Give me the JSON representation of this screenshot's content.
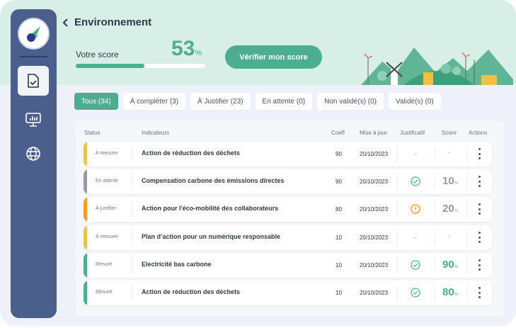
{
  "header": {
    "title": "Environnement",
    "score_label": "Votre score",
    "score_value": "53",
    "score_unit": "%",
    "score_progress": 53,
    "verify_button": "Vérifier mon score"
  },
  "sidebar": {
    "items": [
      {
        "icon": "document-check-icon",
        "active": true
      },
      {
        "icon": "monitor-chart-icon",
        "active": false
      },
      {
        "icon": "globe-icon",
        "active": false
      }
    ]
  },
  "tabs": [
    {
      "label": "Tous (34)",
      "active": true
    },
    {
      "label": "À compléter (3)"
    },
    {
      "label": "À Justifier (23)"
    },
    {
      "label": "En attente (0)"
    },
    {
      "label": "Non validé(s) (0)"
    },
    {
      "label": "Validé(s) (0)"
    }
  ],
  "table": {
    "headers": {
      "status": "Status",
      "indicators": "Indicateurs",
      "coeff": "Coeff",
      "updated": "Mise à jour",
      "proof": "Justificatif",
      "score": "Score",
      "actions": "Actions"
    },
    "rows": [
      {
        "status": "À mesurer",
        "color": "#e8c547",
        "indicator": "Action de réduction des déchets",
        "coeff": "90",
        "date": "20/10/2023",
        "proof": "–",
        "score": "–",
        "score_color": ""
      },
      {
        "status": "En attente",
        "color": "#9a9a9a",
        "indicator": "Compensation carbone des émissions directes",
        "coeff": "90",
        "date": "20/10/2023",
        "proof": "check",
        "score": "10",
        "score_color": "#9a9a9a"
      },
      {
        "status": "À justifier",
        "color": "#f0a020",
        "indicator": "Action pour l'éco-mobilité des collaborateurs",
        "coeff": "80",
        "date": "20/10/2023",
        "proof": "warning",
        "score": "20",
        "score_color": "#9a9a9a"
      },
      {
        "status": "À mesurer",
        "color": "#e8c547",
        "indicator": "Plan d’action pour un numérique responsable",
        "coeff": "10",
        "date": "20/10/2023",
        "proof": "–",
        "score": "–",
        "score_color": ""
      },
      {
        "status": "Mesuré",
        "color": "#4cae8e",
        "indicator": "Electricité bas carbone",
        "coeff": "10",
        "date": "20/10/2023",
        "proof": "check",
        "score": "90",
        "score_color": "#4cae8e"
      },
      {
        "status": "Mesuré",
        "color": "#4cae8e",
        "indicator": "Action de réduction des déchets",
        "coeff": "10",
        "date": "20/10/2023",
        "proof": "check",
        "score": "80",
        "score_color": "#4cae8e"
      }
    ]
  },
  "colors": {
    "accent": "#4cae8e",
    "sidebar": "#4a5f8c",
    "hero": "#d7efe6"
  }
}
